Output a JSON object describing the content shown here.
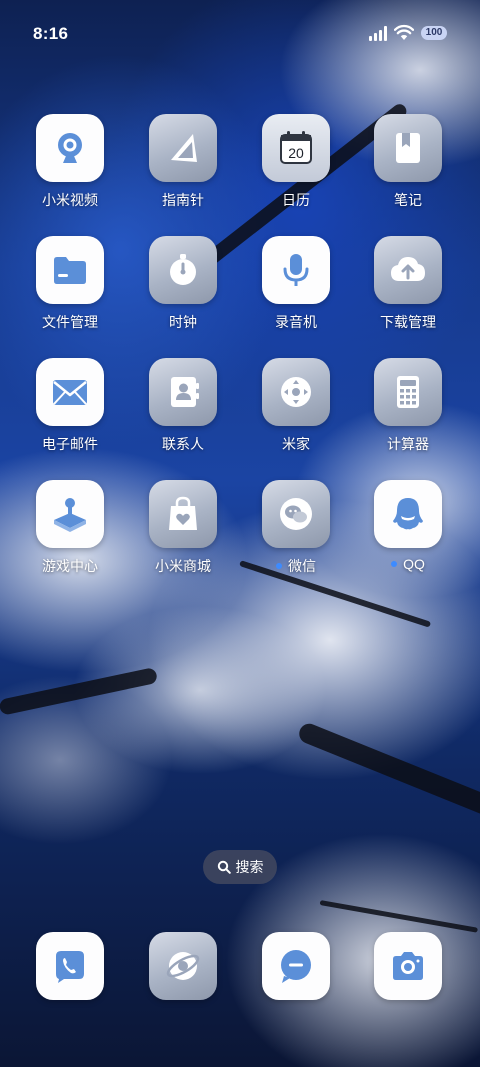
{
  "status_bar": {
    "time": "8:16",
    "battery": "100"
  },
  "apps": [
    {
      "label": "小米视频",
      "icon": "mi-video-icon",
      "style": "white"
    },
    {
      "label": "指南针",
      "icon": "compass-icon",
      "style": "gray"
    },
    {
      "label": "日历",
      "icon": "calendar-icon",
      "style": "white",
      "day": "20"
    },
    {
      "label": "笔记",
      "icon": "notes-icon",
      "style": "gray"
    },
    {
      "label": "文件管理",
      "icon": "folder-icon",
      "style": "white"
    },
    {
      "label": "时钟",
      "icon": "clock-icon",
      "style": "gray"
    },
    {
      "label": "录音机",
      "icon": "microphone-icon",
      "style": "white"
    },
    {
      "label": "下载管理",
      "icon": "cloud-download-icon",
      "style": "gray"
    },
    {
      "label": "电子邮件",
      "icon": "email-icon",
      "style": "white"
    },
    {
      "label": "联系人",
      "icon": "contacts-icon",
      "style": "gray"
    },
    {
      "label": "米家",
      "icon": "mijia-icon",
      "style": "gray"
    },
    {
      "label": "计算器",
      "icon": "calculator-icon",
      "style": "gray"
    },
    {
      "label": "游戏中心",
      "icon": "game-center-icon",
      "style": "white"
    },
    {
      "label": "小米商城",
      "icon": "shopping-bag-icon",
      "style": "gray"
    },
    {
      "label": "微信",
      "icon": "wechat-icon",
      "style": "gray",
      "new_dot": true
    },
    {
      "label": "QQ",
      "icon": "qq-penguin-icon",
      "style": "white",
      "new_dot": true
    }
  ],
  "search": {
    "label": "搜索"
  },
  "dock": [
    {
      "icon": "phone-icon",
      "style": "white"
    },
    {
      "icon": "browser-icon",
      "style": "gray"
    },
    {
      "icon": "messages-icon",
      "style": "white"
    },
    {
      "icon": "camera-icon",
      "style": "white"
    }
  ],
  "colors": {
    "icon_glyph": "#5b8fd8",
    "icon_white_bg": "#fdfdfe",
    "notification_dot": "#3d8bff"
  }
}
